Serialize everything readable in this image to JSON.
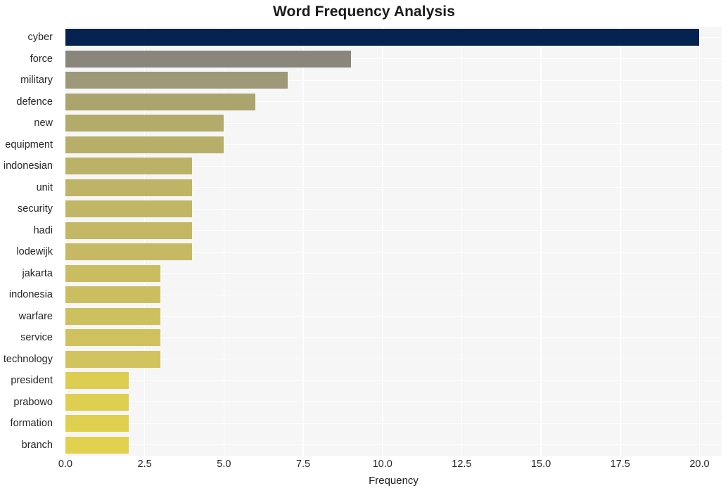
{
  "chart_data": {
    "type": "bar",
    "orientation": "horizontal",
    "title": "Word Frequency Analysis",
    "xlabel": "Frequency",
    "ylabel": "",
    "xlim": [
      0,
      20.7
    ],
    "ylim": [
      0,
      20
    ],
    "grid": true,
    "legend": null,
    "xticks": [
      "0.0",
      "2.5",
      "5.0",
      "7.5",
      "10.0",
      "12.5",
      "15.0",
      "17.5",
      "20.0"
    ],
    "xtick_values": [
      0,
      2.5,
      5,
      7.5,
      10,
      12.5,
      15,
      17.5,
      20
    ],
    "categories": [
      "cyber",
      "force",
      "military",
      "defence",
      "new",
      "equipment",
      "indonesian",
      "unit",
      "security",
      "hadi",
      "lodewijk",
      "jakarta",
      "indonesia",
      "warfare",
      "service",
      "technology",
      "president",
      "prabowo",
      "formation",
      "branch"
    ],
    "values": [
      20,
      9,
      7,
      6,
      5,
      5,
      4,
      4,
      4,
      4,
      4,
      3,
      3,
      3,
      3,
      3,
      2,
      2,
      2,
      2
    ],
    "bar_colors": [
      "#042351",
      "#8a867c",
      "#9d9877",
      "#aba46d",
      "#b3ab6a",
      "#b7ae69",
      "#bcb267",
      "#bfb466",
      "#c1b665",
      "#c3b764",
      "#c5b963",
      "#c9bc61",
      "#cbbe60",
      "#cdc05f",
      "#cfc15e",
      "#d1c35d",
      "#ddcd52",
      "#dfcf50",
      "#e0d04f",
      "#e1d14e"
    ],
    "plot_background": "#f6f6f7",
    "grid_color": "#ffffff",
    "figure_background": "#ffffff",
    "text_color": "#262626"
  }
}
